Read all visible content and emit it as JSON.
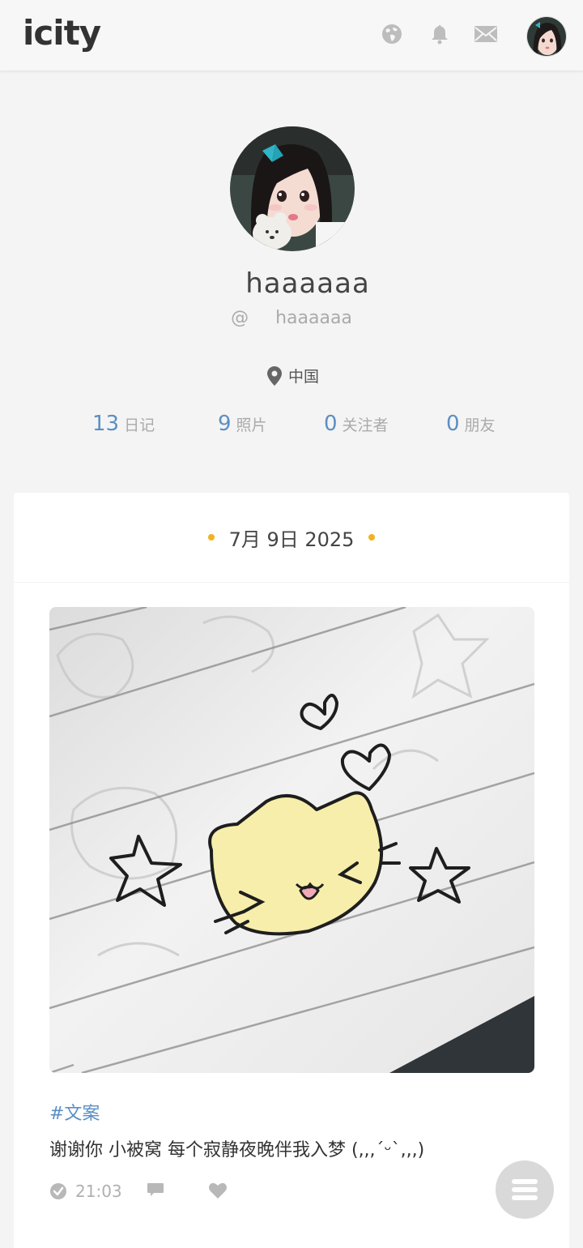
{
  "header": {
    "logo": "icity",
    "icons": [
      "globe-icon",
      "bell-icon",
      "mail-icon"
    ]
  },
  "profile": {
    "name": "haaaaaa",
    "handle_at": "@",
    "handle": "haaaaaa",
    "location": "中国"
  },
  "stats": [
    {
      "num": "13",
      "label": "日记"
    },
    {
      "num": "9",
      "label": "照片"
    },
    {
      "num": "0",
      "label": "关注者"
    },
    {
      "num": "0",
      "label": "朋友"
    }
  ],
  "post": {
    "date": "7月 9日 2025",
    "tag": "#文案",
    "text": "谢谢你 小被窝 每个寂静夜晚伴我入梦 (,,,´ᵕ`,,,)",
    "time": "21:03"
  },
  "colors": {
    "accent": "#5b8fc4",
    "date_dot": "#f2b21e",
    "icon_gray": "#b0b0b0"
  }
}
